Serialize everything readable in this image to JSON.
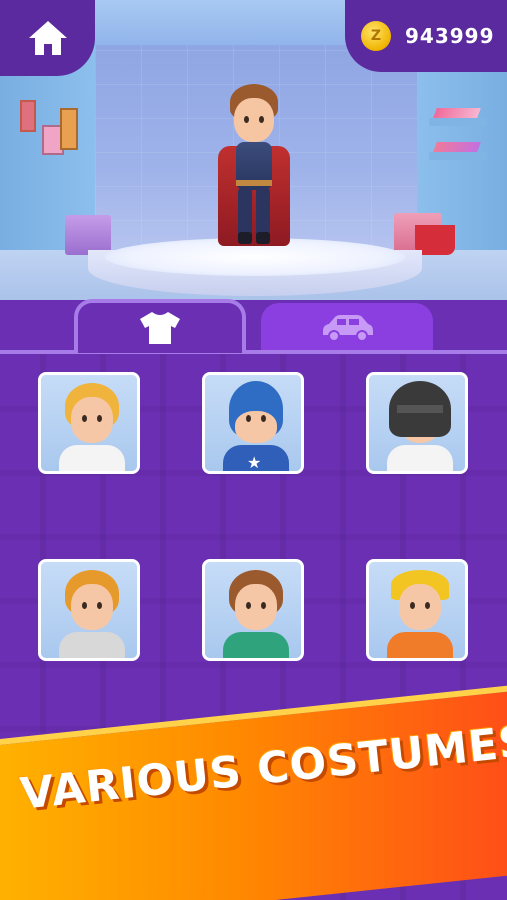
{
  "header": {
    "home_icon": "home-icon",
    "coin_icon": "coin-icon",
    "coin_letter": "Z",
    "coins": "943999"
  },
  "tabs": [
    {
      "id": "clothes",
      "icon": "tshirt-icon",
      "selected": true
    },
    {
      "id": "vehicles",
      "icon": "car-icon",
      "selected": false
    }
  ],
  "costumes": [
    {
      "id": "blonde-white-shirt",
      "hair": "#f0b33c",
      "body": "#f4f4f4"
    },
    {
      "id": "blue-hero-mask",
      "hair": "#2f6cc4",
      "body": "#2f5fb8"
    },
    {
      "id": "helmet-suit",
      "hair": "#3a3a3a",
      "body": "#f4f4f4"
    },
    {
      "id": "blonde-armor",
      "hair": "#e79a2c",
      "body": "#d8d8d8"
    },
    {
      "id": "brown-hair-green-jacket",
      "hair": "#9a5a2e",
      "body": "#2fa37b"
    },
    {
      "id": "yellow-hardhat-worker",
      "hair": "#f2c522",
      "body": "#f07c2a"
    },
    {
      "id": "partial-1",
      "hair": "#a85a2e",
      "body": "#d8d8d8"
    },
    {
      "id": "partial-2",
      "hair": "#9a5a2e",
      "body": "#d8d8d8"
    }
  ],
  "banner": {
    "text": "VARIOUS COSTUMES"
  },
  "colors": {
    "panel": "#6b2fb3",
    "tab_inactive": "#8b3fe0",
    "banner_start": "#ffb300",
    "banner_end": "#ff4a1a"
  }
}
